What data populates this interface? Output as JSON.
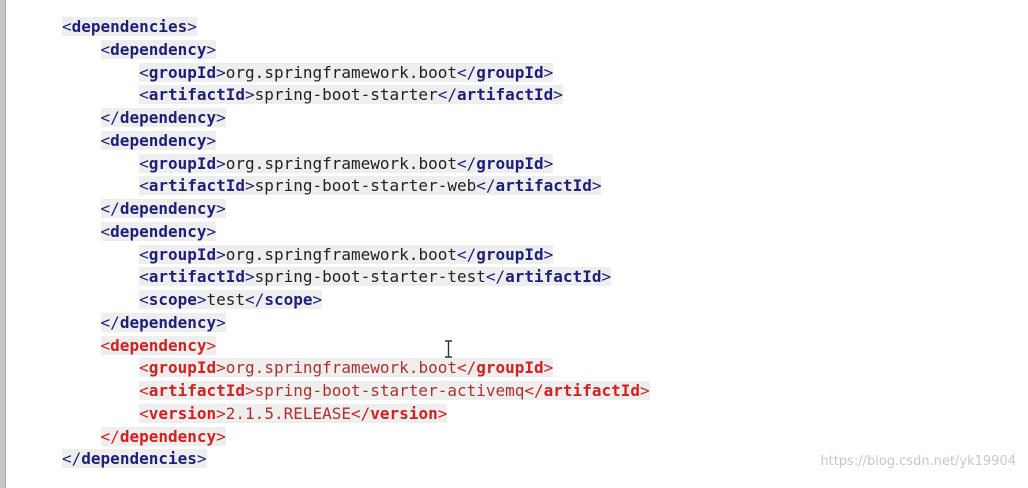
{
  "editor": {
    "lines": [
      {
        "indent": "",
        "slash": "",
        "tag": "dependencies",
        "text": "",
        "close": "",
        "hl": false
      },
      {
        "indent": "    ",
        "slash": "",
        "tag": "dependency",
        "text": "",
        "close": "",
        "hl": false
      },
      {
        "indent": "        ",
        "slash": "",
        "tag": "groupId",
        "text": "org.springframework.boot",
        "close": "groupId",
        "hl": false
      },
      {
        "indent": "        ",
        "slash": "",
        "tag": "artifactId",
        "text": "spring-boot-starter",
        "close": "artifactId",
        "hl": false
      },
      {
        "indent": "    ",
        "slash": "/",
        "tag": "dependency",
        "text": "",
        "close": "",
        "hl": false
      },
      {
        "indent": "    ",
        "slash": "",
        "tag": "dependency",
        "text": "",
        "close": "",
        "hl": false
      },
      {
        "indent": "        ",
        "slash": "",
        "tag": "groupId",
        "text": "org.springframework.boot",
        "close": "groupId",
        "hl": false
      },
      {
        "indent": "        ",
        "slash": "",
        "tag": "artifactId",
        "text": "spring-boot-starter-web",
        "close": "artifactId",
        "hl": false
      },
      {
        "indent": "    ",
        "slash": "/",
        "tag": "dependency",
        "text": "",
        "close": "",
        "hl": false
      },
      {
        "indent": "    ",
        "slash": "",
        "tag": "dependency",
        "text": "",
        "close": "",
        "hl": false
      },
      {
        "indent": "        ",
        "slash": "",
        "tag": "groupId",
        "text": "org.springframework.boot",
        "close": "groupId",
        "hl": false
      },
      {
        "indent": "        ",
        "slash": "",
        "tag": "artifactId",
        "text": "spring-boot-starter-test",
        "close": "artifactId",
        "hl": false
      },
      {
        "indent": "        ",
        "slash": "",
        "tag": "scope",
        "text": "test",
        "close": "scope",
        "hl": false
      },
      {
        "indent": "    ",
        "slash": "/",
        "tag": "dependency",
        "text": "",
        "close": "",
        "hl": false
      },
      {
        "indent": "    ",
        "slash": "",
        "tag": "dependency",
        "text": "",
        "close": "",
        "hl": true
      },
      {
        "indent": "        ",
        "slash": "",
        "tag": "groupId",
        "text": "org.springframework.boot",
        "close": "groupId",
        "hl": true
      },
      {
        "indent": "        ",
        "slash": "",
        "tag": "artifactId",
        "text": "spring-boot-starter-activemq",
        "close": "artifactId",
        "hl": true
      },
      {
        "indent": "        ",
        "slash": "",
        "tag": "version",
        "text": "2.1.5.RELEASE",
        "close": "version",
        "hl": true
      },
      {
        "indent": "    ",
        "slash": "/",
        "tag": "dependency",
        "text": "",
        "close": "",
        "hl": true
      },
      {
        "indent": "",
        "slash": "/",
        "tag": "dependencies",
        "text": "",
        "close": "",
        "hl": false
      }
    ]
  },
  "watermark": "https://blog.csdn.net/yk19904",
  "colors": {
    "tag": "#1f1f7a",
    "highlight": "#d42020",
    "gutter": "#c8c8c8"
  },
  "icons": {
    "cursor": "text-cursor-icon"
  }
}
